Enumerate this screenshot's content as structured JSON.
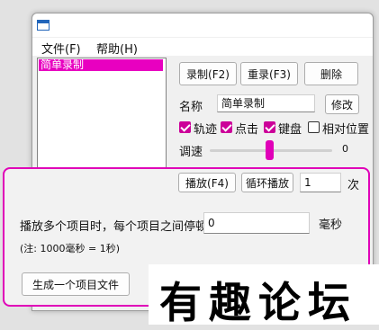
{
  "menu": {
    "file": "文件(F)",
    "help": "帮助(H)"
  },
  "list": {
    "items": [
      "简单录制"
    ]
  },
  "toolbar": {
    "record": "录制(F2)",
    "rerecord": "重录(F3)",
    "delete": "删除"
  },
  "name_row": {
    "label": "名称",
    "value": "简单录制",
    "modify": "修改"
  },
  "options": {
    "trajectory": "轨迹",
    "click": "点击",
    "keyboard": "键盘",
    "relative": "相对位置"
  },
  "options_state": {
    "trajectory": true,
    "click": true,
    "keyboard": true,
    "relative": false
  },
  "speed": {
    "label": "调速",
    "value": "0",
    "level": 0.5
  },
  "playback": {
    "play": "播放(F4)",
    "loop": "循环播放",
    "count": "1",
    "unit": "次"
  },
  "panel": {
    "pause_label": "播放多个项目时，每个项目之间停顿",
    "pause_value": "0",
    "pause_unit": "毫秒",
    "note": "(注: 1000毫秒 = 1秒)",
    "generate": "生成一个项目文件"
  },
  "watermark": {
    "text": "有趣论坛"
  },
  "colors": {
    "accent": "#e000b8"
  }
}
